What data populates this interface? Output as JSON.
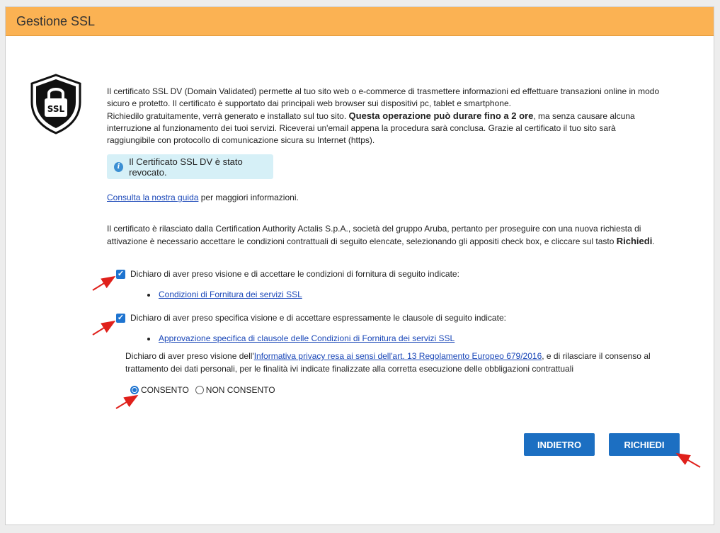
{
  "header": {
    "title": "Gestione SSL"
  },
  "badge": {
    "text": "SSL",
    "icon": "ssl-shield-icon"
  },
  "intro": {
    "p1": "Il certificato SSL DV (Domain Validated) permette al tuo sito web o e-commerce di trasmettere informazioni ed effettuare transazioni online in modo sicuro e protetto. Il certificato è supportato dai principali web browser sui dispositivi pc, tablet e smartphone.",
    "p2_start": "Richiedilo gratuitamente, verrà generato e installato sul tuo sito. ",
    "p2_bold": "Questa operazione può durare fino a 2 ore",
    "p2_end": ", ma senza causare alcuna interruzione al funzionamento dei tuoi servizi. Riceverai un'email appena la procedura sarà conclusa. Grazie al certificato il tuo sito sarà raggiungibile con protocollo di comunicazione sicura su Internet (https)."
  },
  "alert": {
    "text": "Il Certificato SSL DV è stato revocato."
  },
  "guide": {
    "link": "Consulta la nostra guida",
    "rest": " per maggiori informazioni."
  },
  "cert": {
    "text": "Il certificato è rilasciato dalla Certification Authority Actalis S.p.A., società del gruppo Aruba, pertanto per proseguire con una nuova richiesta di attivazione è necessario accettare le condizioni contrattuali di seguito elencate, selezionando gli appositi check box, e cliccare sul tasto ",
    "bold": "Richiedi",
    "end": "."
  },
  "checks": [
    {
      "label": "Dichiaro di aver preso visione e di accettare le condizioni di fornitura di seguito indicate:",
      "link": "Condizioni di Fornitura dei servizi SSL",
      "checked": true
    },
    {
      "label": "Dichiaro di aver preso specifica visione e di accettare espressamente le clausole di seguito indicate:",
      "link": "Approvazione specifica di clausole delle Condizioni di Fornitura dei servizi SSL",
      "checked": true
    }
  ],
  "privacy": {
    "start": "Dichiaro di aver preso visione dell'",
    "link": "Informativa privacy resa ai sensi dell'art. 13 Regolamento Europeo 679/2016",
    "end": ", e di rilasciare il consenso al trattamento dei dati personali, per le finalità ivi indicate finalizzate alla corretta esecuzione delle obbligazioni contrattuali"
  },
  "consent": {
    "yes": "CONSENTO",
    "no": "NON CONSENTO",
    "selected": "CONSENTO"
  },
  "buttons": {
    "back": "INDIETRO",
    "request": "RICHIEDI"
  },
  "colors": {
    "header": "#fbb253",
    "button": "#1c6fc2",
    "alert_bg": "#d6f0f7",
    "arrow": "#e0201b"
  }
}
